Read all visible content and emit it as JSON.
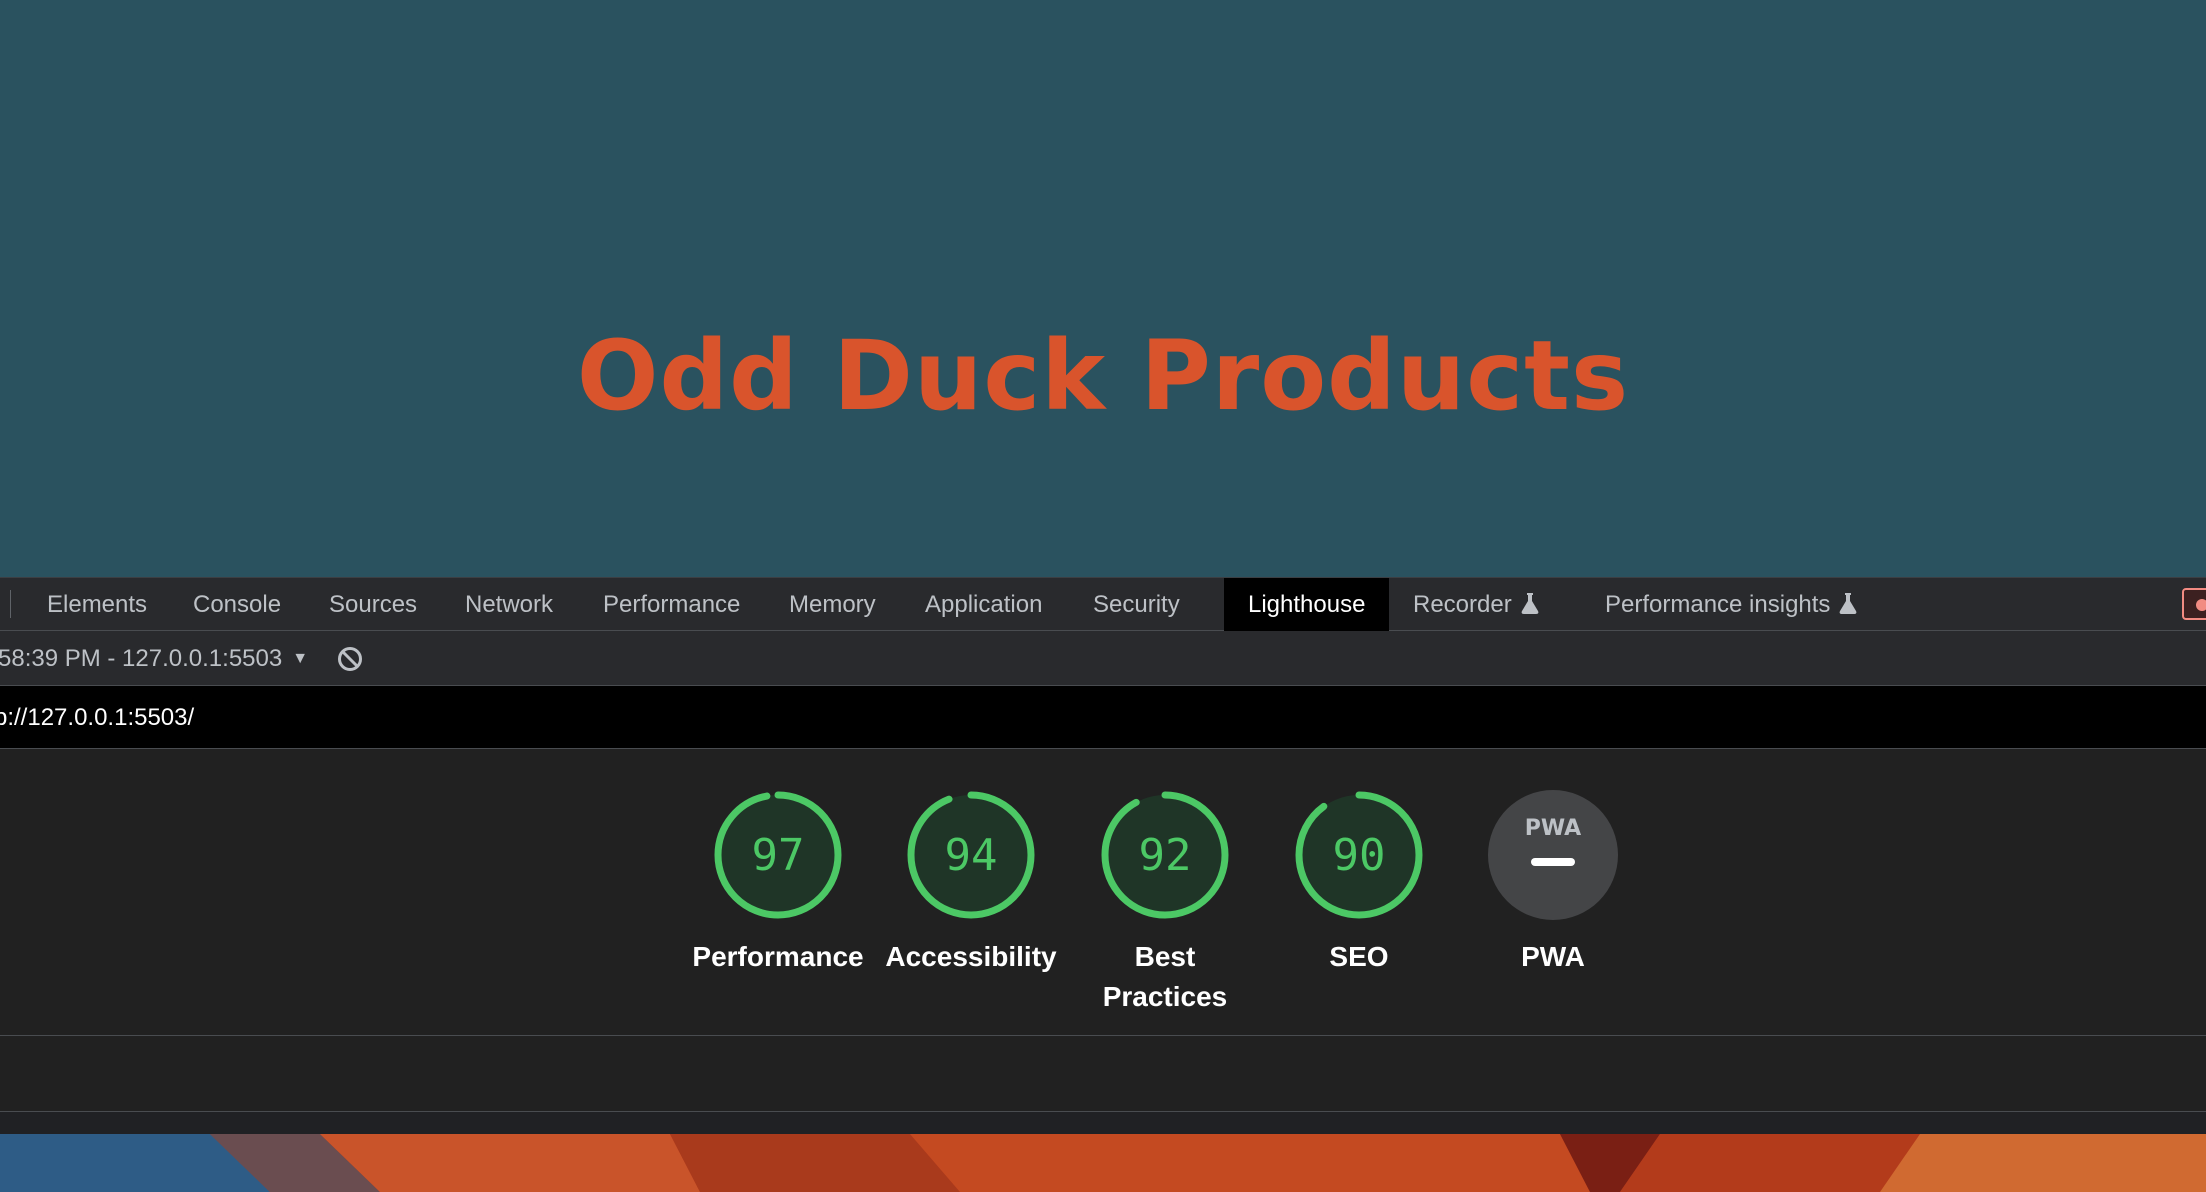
{
  "page": {
    "heading": "Odd Duck Products",
    "background_color": "#2a525f",
    "heading_color": "#d9542c"
  },
  "devtools": {
    "tabs": [
      {
        "label": "Elements",
        "active": false,
        "experimental": false
      },
      {
        "label": "Console",
        "active": false,
        "experimental": false
      },
      {
        "label": "Sources",
        "active": false,
        "experimental": false
      },
      {
        "label": "Network",
        "active": false,
        "experimental": false
      },
      {
        "label": "Performance",
        "active": false,
        "experimental": false
      },
      {
        "label": "Memory",
        "active": false,
        "experimental": false
      },
      {
        "label": "Application",
        "active": false,
        "experimental": false
      },
      {
        "label": "Security",
        "active": false,
        "experimental": false
      },
      {
        "label": "Lighthouse",
        "active": true,
        "experimental": false
      },
      {
        "label": "Recorder",
        "active": false,
        "experimental": true,
        "icon": "flask-icon"
      },
      {
        "label": "Performance insights",
        "active": false,
        "experimental": true,
        "icon": "flask-icon"
      }
    ],
    "toolbar": {
      "report_selector": "58:39 PM - 127.0.0.1:5503",
      "clear_icon": "block-icon"
    },
    "url": "p://127.0.0.1:5503/",
    "scores": [
      {
        "value": "97",
        "score": 97,
        "label": "Performance",
        "color": "#4cc865"
      },
      {
        "value": "94",
        "score": 94,
        "label": "Accessibility",
        "color": "#4cc865"
      },
      {
        "value": "92",
        "score": 92,
        "label": "Best Practices",
        "color": "#4cc865"
      },
      {
        "value": "90",
        "score": 90,
        "label": "SEO",
        "color": "#4cc865"
      },
      {
        "value": "PWA",
        "score": null,
        "label": "PWA",
        "color": "#bdc1c6"
      }
    ]
  }
}
